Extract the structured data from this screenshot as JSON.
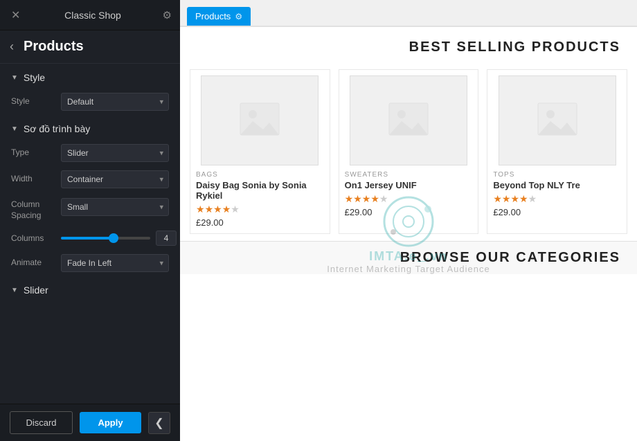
{
  "panel": {
    "header": {
      "close_label": "✕",
      "title": "Classic Shop",
      "gear_label": "⚙"
    },
    "back_arrow": "‹",
    "section_title": "Products",
    "style_section": {
      "label": "Style",
      "arrow": "▼",
      "style_label": "Style",
      "style_value": "Default"
    },
    "layout_section": {
      "label": "Sơ đồ trình bày",
      "arrow": "▼",
      "type_label": "Type",
      "type_value": "Slider",
      "width_label": "Width",
      "width_value": "Container",
      "column_spacing_label": "Column Spacing",
      "column_spacing_value": "Small",
      "columns_label": "Columns",
      "columns_value": "4",
      "animate_label": "Animate",
      "animate_value": "Fade In Left"
    },
    "slider_section": {
      "label": "Slider",
      "arrow": "▼"
    },
    "discard_label": "Discard",
    "apply_label": "Apply",
    "toggle_label": "❮"
  },
  "right": {
    "tab_label": "Products",
    "best_selling_title": "BEST SELLING PRODUCTS",
    "browse_categories_title": "BROWSE OUR CATEGORIES",
    "products": [
      {
        "category": "BAGS",
        "name": "Daisy Bag Sonia by Sonia Rykiel",
        "stars": [
          1,
          1,
          1,
          1,
          0.5
        ],
        "price": "£29.00"
      },
      {
        "category": "SWEATERS",
        "name": "On1 Jersey UNIF",
        "stars": [
          1,
          1,
          1,
          1,
          0.5
        ],
        "price": "£29.00"
      },
      {
        "category": "TOPS",
        "name": "Beyond Top NLY Tre",
        "stars": [
          1,
          1,
          1,
          1,
          0.5
        ],
        "price": "£29.00"
      }
    ],
    "watermark": {
      "text": "Internet Marketing Target Audience",
      "abbr": "IMTA.e_.vn"
    }
  }
}
